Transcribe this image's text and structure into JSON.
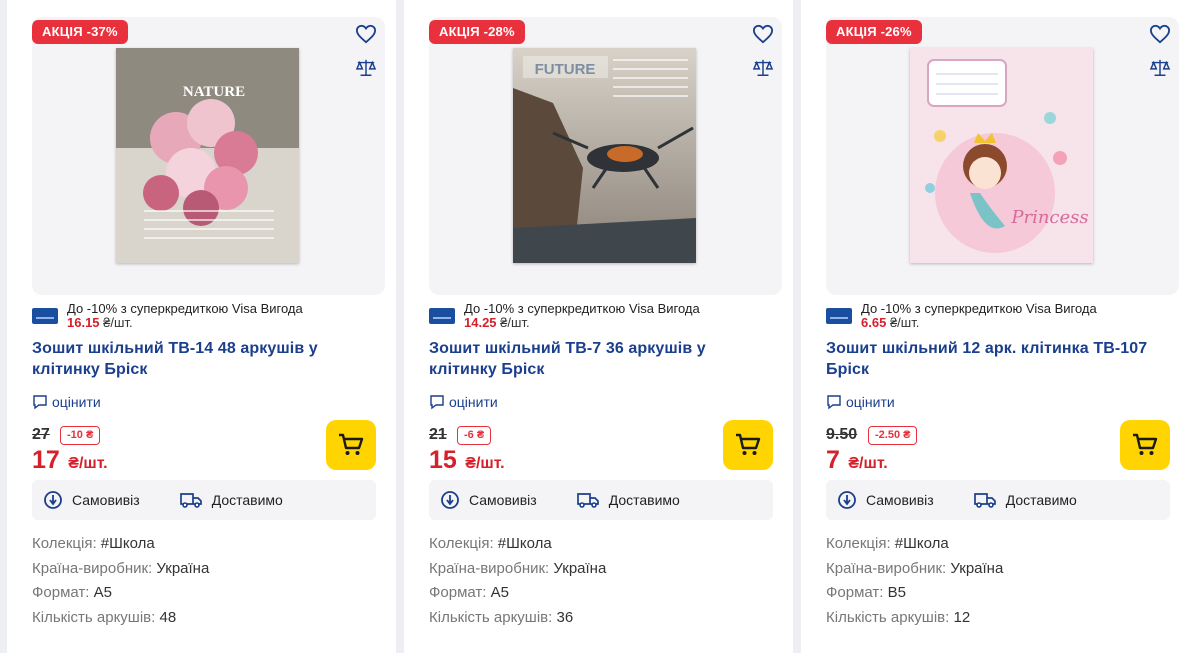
{
  "products": [
    {
      "badge": "АКЦІЯ -37%",
      "visa_text": "До -10% з суперкредиткою Visa Вигода",
      "visa_price": "16.15",
      "visa_unit": "₴/шт.",
      "title": "Зошит шкільний ТВ-14 48 аркушів у клітинку Бріск",
      "rate_label": "оцінити",
      "old_price": "27",
      "discount": "-10 ₴",
      "price": "17",
      "price_unit": "₴/шт.",
      "pickup": "Самовивіз",
      "delivery": "Доставимо",
      "specs": [
        {
          "label": "Колекція:",
          "value": "#Школа"
        },
        {
          "label": "Країна-виробник:",
          "value": "Україна"
        },
        {
          "label": "Формат:",
          "value": "А5"
        },
        {
          "label": "Кількість аркушів:",
          "value": "48"
        }
      ],
      "cover_text": "NATURE"
    },
    {
      "badge": "АКЦІЯ -28%",
      "visa_text": "До -10% з суперкредиткою Visa Вигода",
      "visa_price": "14.25",
      "visa_unit": "₴/шт.",
      "title": "Зошит шкільний ТВ-7 36 аркушів у клітинку Бріск",
      "rate_label": "оцінити",
      "old_price": "21",
      "discount": "-6 ₴",
      "price": "15",
      "price_unit": "₴/шт.",
      "pickup": "Самовивіз",
      "delivery": "Доставимо",
      "specs": [
        {
          "label": "Колекція:",
          "value": "#Школа"
        },
        {
          "label": "Країна-виробник:",
          "value": "Україна"
        },
        {
          "label": "Формат:",
          "value": "А5"
        },
        {
          "label": "Кількість аркушів:",
          "value": "36"
        }
      ],
      "cover_text": "FUTURE"
    },
    {
      "badge": "АКЦІЯ -26%",
      "visa_text": "До -10% з суперкредиткою Visa Вигода",
      "visa_price": "6.65",
      "visa_unit": "₴/шт.",
      "title": "Зошит шкільний 12 арк. клітинка ТВ-107 Бріск",
      "rate_label": "оцінити",
      "old_price": "9.50",
      "discount": "-2.50 ₴",
      "price": "7",
      "price_unit": "₴/шт.",
      "pickup": "Самовивіз",
      "delivery": "Доставимо",
      "specs": [
        {
          "label": "Колекція:",
          "value": "#Школа"
        },
        {
          "label": "Країна-виробник:",
          "value": "Україна"
        },
        {
          "label": "Формат:",
          "value": "В5"
        },
        {
          "label": "Кількість аркушів:",
          "value": "12"
        }
      ],
      "cover_text": "Princess"
    }
  ],
  "icons": {
    "favorite": "heart-icon",
    "compare": "scales-icon",
    "rate": "comment-icon",
    "cart": "cart-icon",
    "pickup": "location-pin-icon",
    "delivery": "truck-icon",
    "visa": "visa-card-icon"
  },
  "colors": {
    "badge": "#e8313d",
    "price": "#d6202b",
    "title": "#1b3f8c",
    "cart_button": "#ffd400"
  }
}
